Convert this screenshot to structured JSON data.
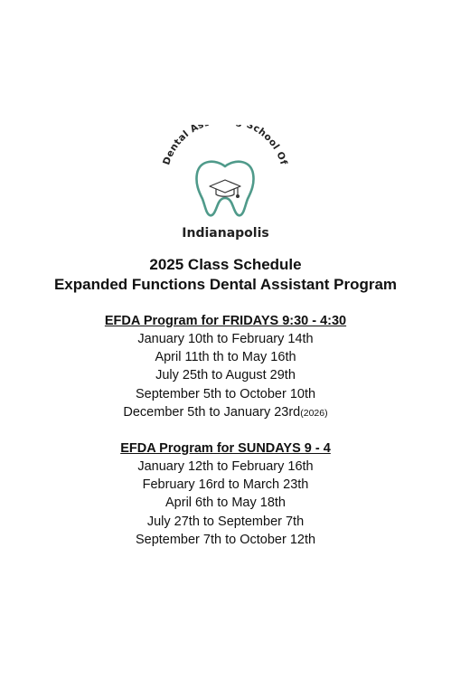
{
  "logo": {
    "arc_text": "Dental Assisting School Of",
    "city": "Indianapolis",
    "icon": "tooth-with-graduation-cap-icon",
    "accent_color": "#4f9a8a"
  },
  "header": {
    "title": "2025 Class Schedule",
    "subtitle": "Expanded Functions Dental Assistant Program"
  },
  "fridays": {
    "heading": "EFDA Program for FRIDAYS 9:30 - 4:30",
    "rows": [
      "January 10th to February 14th",
      "April 11th th to May 16th",
      "July 25th to August 29th",
      "September 5th to October 10th"
    ],
    "last_row": "December 5th to January 23rd",
    "last_row_note": "(2026)"
  },
  "sundays": {
    "heading": "EFDA Program for SUNDAYS 9 - 4",
    "rows": [
      "January 12th to February 16th",
      "February 16rd to March 23th",
      "April 6th to May 18th",
      "July 27th to September 7th",
      "September 7th to October 12th"
    ]
  }
}
